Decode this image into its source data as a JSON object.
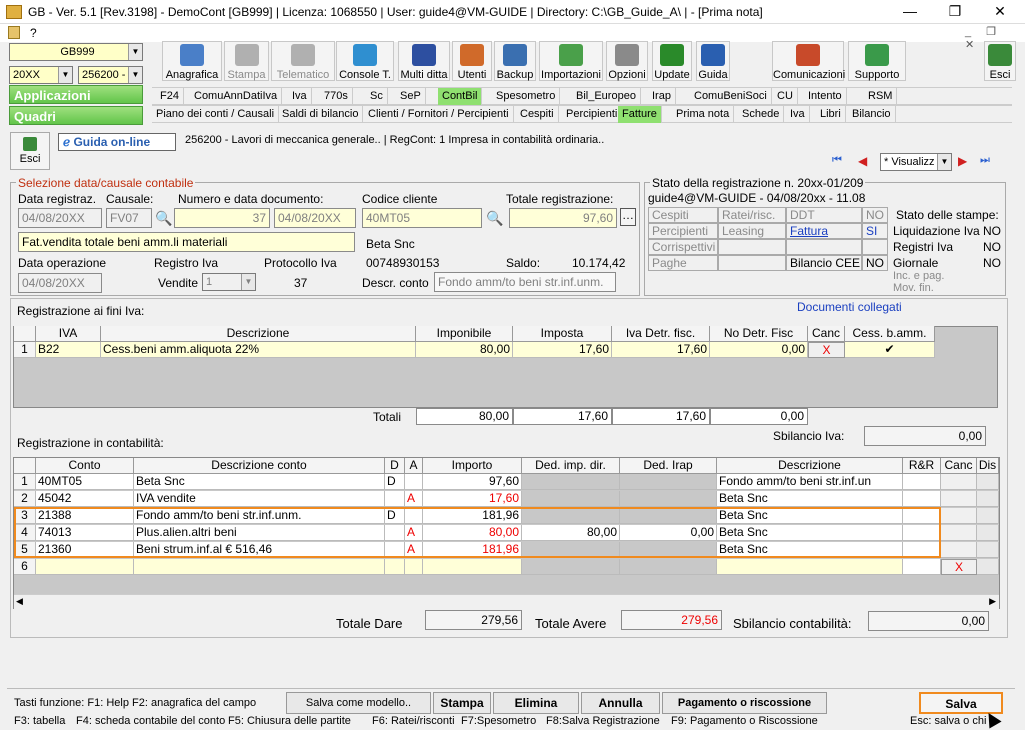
{
  "window": {
    "title": "GB - Ver. 5.1 [Rev.3198] -  DemoCont [GB999]   | Licenza: 1068550 | User: guide4@VM-GUIDE | Directory: C:\\GB_Guide_A\\ | - [Prima nota]",
    "menu_q": "?"
  },
  "left": {
    "company": "GB999",
    "year": "20XX",
    "activity": "256200 -",
    "applicazioni": "Applicazioni",
    "quadri": "Quadri"
  },
  "toolbar": [
    {
      "label": "Anagrafica",
      "icon": "book-icon",
      "color": "#4a7fc8",
      "dis": false
    },
    {
      "label": "Stampa",
      "icon": "printer-icon",
      "color": "#b0b0b0",
      "dis": true
    },
    {
      "label": "Telematico",
      "icon": "telematic-icon",
      "color": "#b0b0b0",
      "dis": true
    },
    {
      "label": "Console T.",
      "icon": "console-icon",
      "color": "#2f8fd0",
      "dis": false
    },
    {
      "label": "Multi ditta",
      "icon": "multiditta-icon",
      "color": "#2d4fa0",
      "dis": false
    },
    {
      "label": "Utenti",
      "icon": "users-icon",
      "color": "#d06a2a",
      "dis": false
    },
    {
      "label": "Backup",
      "icon": "backup-icon",
      "color": "#3a6fb0",
      "dis": false
    },
    {
      "label": "Importazioni",
      "icon": "import-icon",
      "color": "#4aa04a",
      "dis": false
    },
    {
      "label": "Opzioni",
      "icon": "wrench-icon",
      "color": "#8a8a8a",
      "dis": false
    },
    {
      "label": "Update",
      "icon": "update-icon",
      "color": "#2a8a2a",
      "dis": false
    },
    {
      "label": "Guida",
      "icon": "help-icon",
      "color": "#2a5fb0",
      "dis": false
    },
    {
      "label": "Comunicazioni",
      "icon": "comunicazioni-icon",
      "color": "#c84a2a",
      "dis": false
    },
    {
      "label": "Supporto",
      "icon": "supporto-icon",
      "color": "#3a9a4a",
      "dis": false
    },
    {
      "label": "Esci",
      "icon": "exit-icon",
      "color": "#3a8a3a",
      "dis": false
    }
  ],
  "tabs1": [
    "F24",
    "ComuAnnDatiIva",
    "Iva",
    "770s",
    "Sc",
    "SeP",
    "ContBil",
    "Spesometro",
    "Bil_Europeo",
    "Irap",
    "ComuBeniSoci",
    "CU",
    "Intento",
    "RSM"
  ],
  "tabs2": [
    "Piano dei conti / Causali",
    "Saldi di bilancio",
    "Clienti / Fornitori / Percipienti",
    "Cespiti",
    "Percipienti",
    "Fatture",
    "Prima nota",
    "Schede",
    "Iva",
    "Libri",
    "Bilancio"
  ],
  "sub": {
    "esci": "Esci",
    "guida": "Guida on-line",
    "info": "256200 - Lavori di meccanica generale..  | RegCont: 1 Impresa  in contabilità ordinaria..",
    "view": "* Visualizz"
  },
  "sel": {
    "title": "Selezione data/causale contabile",
    "lbl_data": "Data registraz.",
    "lbl_causale": "Causale:",
    "lbl_num": "Numero e data documento:",
    "data": "04/08/20XX",
    "causale": "FV07",
    "numero": "37",
    "data_doc": "04/08/20XX",
    "descr": "Fat.vendita totale beni amm.li materiali",
    "lbl_dataop": "Data operazione",
    "lbl_reg": "Registro Iva",
    "lbl_prot": "Protocollo Iva",
    "dataop": "04/08/20XX",
    "vendite": "Vendite",
    "registro": "1",
    "protocollo": "37",
    "lbl_cod": "Codice cliente",
    "lbl_tot": "Totale registrazione:",
    "codice": "40MT05",
    "totale": "97,60",
    "cliente": "Beta Snc",
    "piva": "00748930153",
    "lbl_saldo": "Saldo:",
    "saldo": "10.174,42",
    "lbl_descr_conto": "Descr. conto",
    "descr_conto": "Fondo amm/to beni str.inf.unm."
  },
  "stato": {
    "title": "Stato della registrazione n. 20xx-01/209",
    "sub": "guide4@VM-GUIDE - 04/08/20xx - 11.08",
    "rows": [
      [
        "Cespiti",
        "Ratei/risc.",
        "DDT",
        "NO"
      ],
      [
        "Percipienti",
        "Leasing",
        "Fattura",
        "SI"
      ],
      [
        "Corrispettivi",
        "",
        "",
        ""
      ],
      [
        "Paghe",
        "",
        "Bilancio CEE",
        "NO"
      ]
    ],
    "stampe_title": "Stato delle stampe:",
    "stampe": [
      [
        "Liquidazione Iva",
        "NO"
      ],
      [
        "Registri Iva",
        "NO"
      ],
      [
        "Giornale",
        "NO"
      ],
      [
        "Inc. e pag. Mov. fin.",
        ""
      ]
    ]
  },
  "iva": {
    "title": "Registrazione ai fini Iva:",
    "link": "Documenti collegati",
    "headers": [
      "IVA",
      "Descrizione",
      "Imponibile",
      "Imposta",
      "Iva Detr. fisc.",
      "No Detr. Fisc",
      "Canc",
      "Cess. b.amm."
    ],
    "row": {
      "n": "1",
      "iva": "B22",
      "descr": "Cess.beni amm.aliquota 22%",
      "imponibile": "80,00",
      "imposta": "17,60",
      "detr": "17,60",
      "nodetr": "0,00",
      "canc": "X",
      "cess": "✔"
    },
    "totali_label": "Totali",
    "totali": [
      "80,00",
      "17,60",
      "17,60",
      "0,00"
    ],
    "sbil_label": "Sbilancio Iva:",
    "sbil": "0,00"
  },
  "cont": {
    "title": "Registrazione in contabilità:",
    "headers": [
      "Conto",
      "Descrizione conto",
      "D",
      "A",
      "Importo",
      "Ded. imp. dir.",
      "Ded. Irap",
      "Descrizione",
      "R&R",
      "Canc",
      "Dis"
    ],
    "rows": [
      {
        "n": "1",
        "conto": "40MT05",
        "descr": "Beta Snc",
        "d": "D",
        "a": "",
        "importo": "97,60",
        "ded": "",
        "irap": "",
        "desc2": "Fondo amm/to beni str.inf.un",
        "red": false
      },
      {
        "n": "2",
        "conto": "45042",
        "descr": "IVA vendite",
        "d": "",
        "a": "A",
        "importo": "17,60",
        "ded": "",
        "irap": "",
        "desc2": "Beta Snc",
        "red": true
      },
      {
        "n": "3",
        "conto": "21388",
        "descr": "Fondo amm/to beni str.inf.unm.",
        "d": "D",
        "a": "",
        "importo": "181,96",
        "ded": "",
        "irap": "",
        "desc2": "Beta Snc",
        "red": false
      },
      {
        "n": "4",
        "conto": "74013",
        "descr": "Plus.alien.altri beni",
        "d": "",
        "a": "A",
        "importo": "80,00",
        "ded": "80,00",
        "irap": "0,00",
        "desc2": "Beta Snc",
        "red": true
      },
      {
        "n": "5",
        "conto": "21360",
        "descr": "Beni strum.inf.al € 516,46",
        "d": "",
        "a": "A",
        "importo": "181,96",
        "ded": "",
        "irap": "",
        "desc2": "Beta Snc",
        "red": true
      },
      {
        "n": "6",
        "conto": "",
        "descr": "",
        "d": "",
        "a": "",
        "importo": "",
        "ded": "",
        "irap": "",
        "desc2": "",
        "red": false
      }
    ],
    "canc6": "X"
  },
  "totals": {
    "dare_label": "Totale Dare",
    "dare": "279,56",
    "avere_label": "Totale Avere",
    "avere": "279,56",
    "sbil_label": "Sbilancio contabilità:",
    "sbil": "0,00"
  },
  "footer": {
    "tasti": "Tasti funzione: F1: Help  F2: anagrafica del campo",
    "salva_modello": "Salva come modello..",
    "stampa": "Stampa",
    "elimina": "Elimina",
    "annulla": "Annulla",
    "pagamento": "Pagamento o riscossione",
    "salva": "Salva",
    "line2": [
      "F3: tabella",
      "F4: scheda contabile del conto",
      "F5: Chiusura delle partite",
      "F6: Ratei/risconti",
      "F7:Spesometro",
      "F8:Salva Registrazione",
      "F9: Pagamento o Riscossione",
      "Esc: salva o chi"
    ]
  }
}
